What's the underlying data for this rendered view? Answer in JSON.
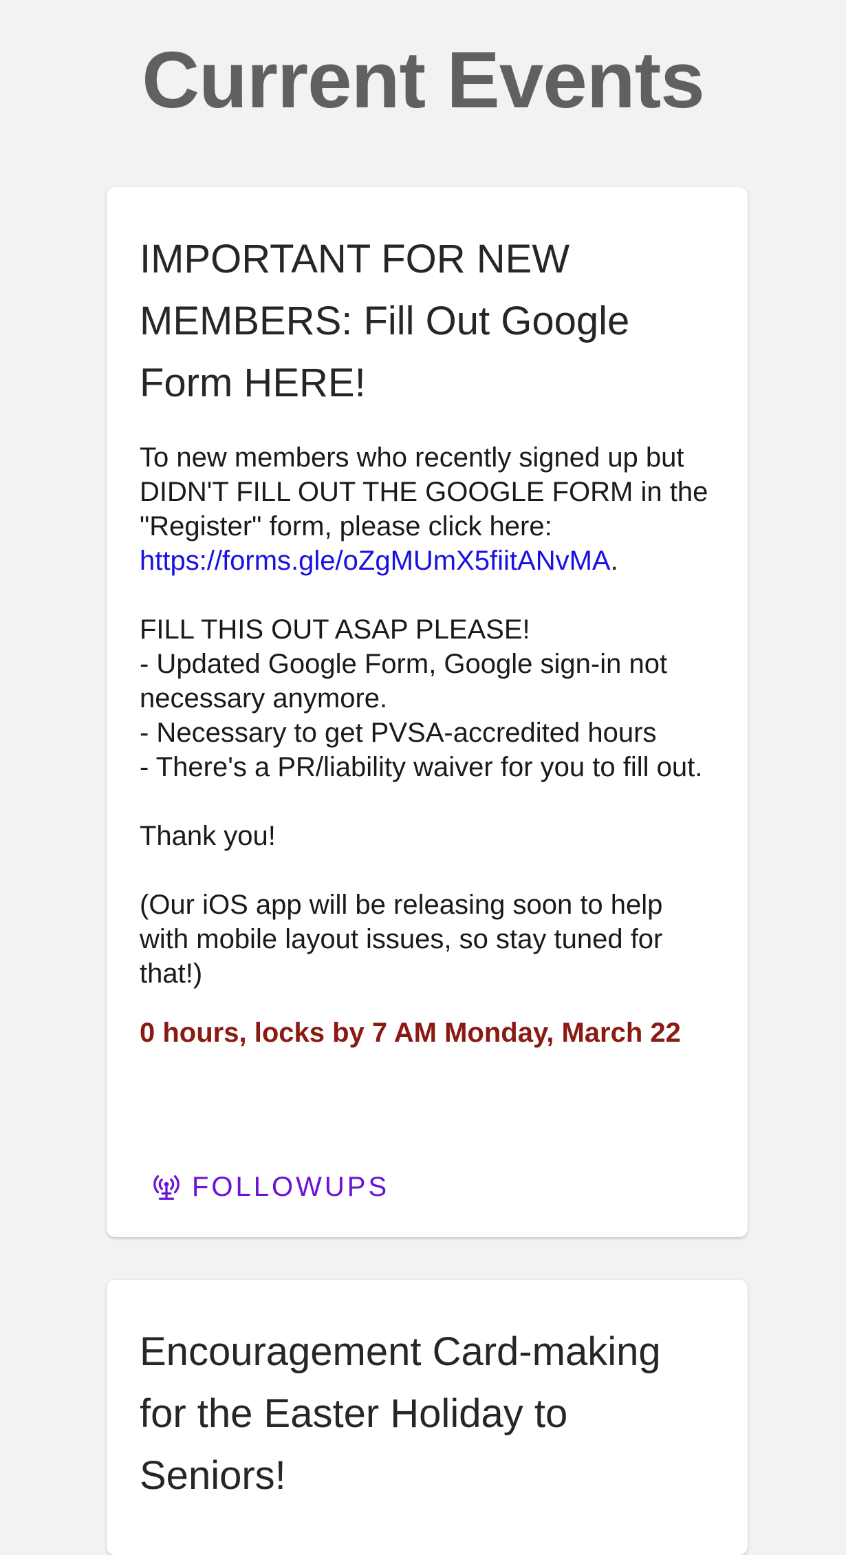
{
  "page": {
    "title": "Current Events"
  },
  "events": [
    {
      "title": "IMPORTANT FOR NEW MEMBERS: Fill Out Google Form HERE!",
      "body_intro": "To new members who recently signed up but DIDN'T FILL OUT THE GOOGLE FORM in the \"Register\" form, please click here: ",
      "link_text": "https://forms.gle/oZgMUmX5fiitANvMA",
      "body_after_link": ".\n\nFILL THIS OUT ASAP PLEASE!\n- Updated Google Form, Google sign-in not necessary anymore.\n- Necessary to get PVSA-accredited hours\n- There's a PR/liability waiver for you to fill out.\n\nThank you!\n\n(Our iOS app will be releasing soon to help with mobile layout issues, so stay tuned for that!)",
      "hours_text": "0 hours, locks by 7 AM Monday, March 22",
      "followups_label": "FOLLOWUPS",
      "followups_icon": "broadcast-tower-icon"
    },
    {
      "title": "Encouragement Card-making for the Easter Holiday to Seniors!"
    }
  ],
  "colors": {
    "background": "#f2f2f2",
    "title": "#606060",
    "link": "#1a10e0",
    "hours": "#8b1a12",
    "followups": "#6a12d8"
  }
}
